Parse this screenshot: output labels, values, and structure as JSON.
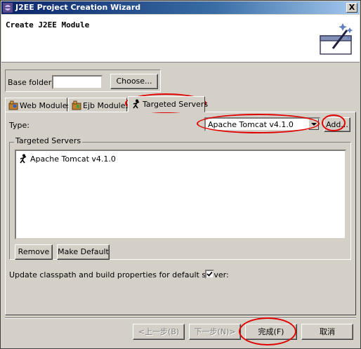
{
  "window": {
    "title": "J2EE Project Creation Wizard",
    "close_label": "X"
  },
  "banner": {
    "heading": "Create J2EE Module",
    "icon": "wizard-graphic-icon"
  },
  "base_folder": {
    "label": "Base folder:",
    "value": "",
    "choose_label": "Choose..."
  },
  "tabs": [
    {
      "label": "Web Modules",
      "icon": "web-module-icon",
      "active": false
    },
    {
      "label": "Ejb Modules",
      "icon": "ejb-module-icon",
      "active": false
    },
    {
      "label": "Targeted Servers",
      "icon": "server-icon",
      "active": true
    }
  ],
  "type": {
    "label": "Type:",
    "selected": "Apache Tomcat v4.1.0",
    "add_label": "Add..."
  },
  "servers": {
    "group_title": "Targeted Servers",
    "items": [
      {
        "label": "Apache Tomcat v4.1.0",
        "icon": "server-icon"
      }
    ],
    "remove_label": "Remove",
    "make_default_label": "Make Default"
  },
  "update": {
    "label": "Update classpath and build properties for default server:",
    "checked": true
  },
  "footer": {
    "back_label": "<上一步(B)",
    "next_label": "下一步(N)>",
    "finish_label": "完成(F)",
    "cancel_label": "取消"
  },
  "colors": {
    "title_bar": "#0a246a",
    "annotation": "#e00000",
    "dialog_bg": "#d4d0c8"
  }
}
